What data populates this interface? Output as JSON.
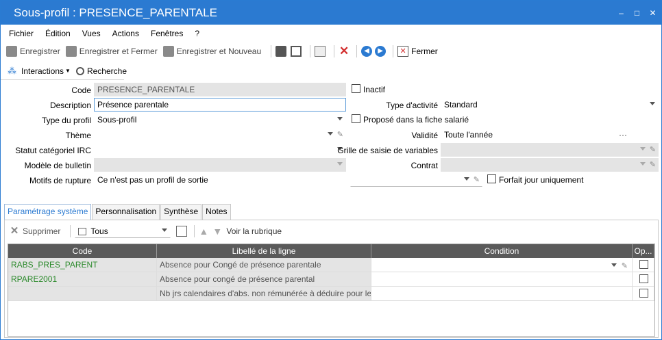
{
  "window": {
    "title": "Sous-profil : PRESENCE_PARENTALE",
    "minimize": "‒",
    "restore": "□",
    "close": "✕"
  },
  "menu": [
    "Fichier",
    "Édition",
    "Vues",
    "Actions",
    "Fenêtres",
    "?"
  ],
  "toolbar": {
    "save": "Enregistrer",
    "save_close": "Enregistrer et Fermer",
    "save_new": "Enregistrer et Nouveau",
    "close": "Fermer"
  },
  "toolbar2": {
    "interactions": "Interactions",
    "search": "Recherche"
  },
  "form": {
    "code_label": "Code",
    "code_value": "PRESENCE_PARENTALE",
    "inactive_label": "Inactif",
    "description_label": "Description",
    "description_value": "Présence parentale",
    "activity_type_label": "Type d'activité",
    "activity_type_value": "Standard",
    "profile_type_label": "Type du profil",
    "profile_type_value": "Sous-profil",
    "proposed_label": "Proposé dans la fiche salarié",
    "theme_label": "Thème",
    "theme_value": "",
    "validity_label": "Validité",
    "validity_value": "Toute l'année",
    "validity_btn": "···",
    "irc_label": "Statut catégoriel IRC",
    "irc_value": "",
    "variables_label": "Grille de saisie de variables",
    "variables_value": "",
    "bulletin_label": "Modèle de bulletin",
    "bulletin_value": "",
    "contract_label": "Contrat",
    "contract_value": "",
    "rupture_label": "Motifs de rupture",
    "rupture_value": "Ce n'est pas un profil de sortie",
    "forfait_label": "Forfait jour uniquement"
  },
  "tabs": [
    "Paramétrage système",
    "Personnalisation",
    "Synthèse",
    "Notes"
  ],
  "grid_toolbar": {
    "delete": "Supprimer",
    "filter": "Tous",
    "go_to": "Voir la rubrique"
  },
  "grid": {
    "headers": [
      "Code",
      "Libellé de la ligne",
      "Condition",
      "Op..."
    ],
    "rows": [
      {
        "code": "RABS_PRES_PARENT",
        "label": "Absence pour Congé de présence parentale",
        "condition": ""
      },
      {
        "code": "RPARE2001",
        "label": "Absence pour congé de présence parental",
        "condition": ""
      },
      {
        "code": "",
        "label": "Nb jrs calendaires d'abs. non rémunérée à déduire pour le cal...",
        "condition": ""
      }
    ]
  },
  "colors": {
    "accent": "#2b7ad1",
    "code_text": "#2c8a2c",
    "delete_red": "#d32f2f"
  }
}
